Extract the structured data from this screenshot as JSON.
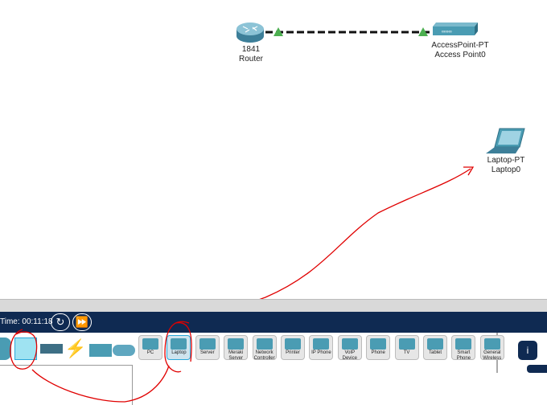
{
  "topology": {
    "router": {
      "model": "1841",
      "name": "Router"
    },
    "access_point": {
      "model": "AccessPoint-PT",
      "name": "Access Point0"
    },
    "laptop": {
      "model": "Laptop-PT",
      "name": "Laptop0"
    }
  },
  "sim": {
    "time_label": "Time: 00:11:18"
  },
  "device_types": [
    {
      "label": "PC"
    },
    {
      "label": "Laptop"
    },
    {
      "label": "Server"
    },
    {
      "label": "Meraki Server"
    },
    {
      "label": "Network Controller"
    },
    {
      "label": "Printer"
    },
    {
      "label": "IP Phone"
    },
    {
      "label": "VoIP Device"
    },
    {
      "label": "Phone"
    },
    {
      "label": "TV"
    },
    {
      "label": "Tablet"
    },
    {
      "label": "Smart Phone"
    },
    {
      "label": "General Wireless"
    }
  ],
  "selected_device": "Laptop",
  "colors": {
    "navbar": "#0f2a52",
    "annotation": "#e00000",
    "link_up": "#4caf50"
  }
}
